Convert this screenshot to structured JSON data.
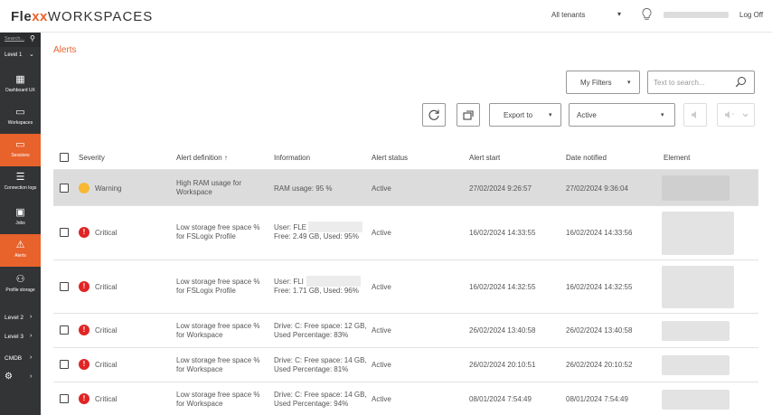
{
  "brand": {
    "flex": "Fle",
    "xx": "xx",
    "workspaces": "WORKSPACES"
  },
  "topbar": {
    "tenant": "All tenants",
    "logoff": "Log Off"
  },
  "sidebar": {
    "search_placeholder": "Search...",
    "level1": "Level 1",
    "items": [
      {
        "label": "Dashboard UX",
        "icon": "dashboard-icon"
      },
      {
        "label": "Workspaces",
        "icon": "monitor-icon"
      },
      {
        "label": "Sessions",
        "icon": "sessions-icon"
      },
      {
        "label": "Connection logs",
        "icon": "list-icon"
      },
      {
        "label": "Jobs",
        "icon": "jobs-icon"
      },
      {
        "label": "Alerts",
        "icon": "alert-icon"
      },
      {
        "label": "Profile storage",
        "icon": "profile-storage-icon"
      }
    ],
    "levels": [
      "Level 2",
      "Level 3",
      "CMDB"
    ]
  },
  "page": {
    "title": "Alerts"
  },
  "toolbar": {
    "my_filters": "My Filters",
    "search_placeholder": "Text to search...",
    "export": "Export to",
    "status_filter": "Active"
  },
  "table": {
    "headers": [
      "Severity",
      "Alert definition ↑",
      "Information",
      "Alert status",
      "Alert start",
      "Date notified",
      "Element"
    ],
    "rows": [
      {
        "severity": "Warning",
        "definition": [
          "High RAM usage for",
          "Workspace"
        ],
        "info": [
          "RAM usage: 95 %"
        ],
        "status": "Active",
        "start": "27/02/2024 9:26:57",
        "notified": "27/02/2024 9:36:04"
      },
      {
        "severity": "Critical",
        "definition": [
          "Low storage free space %",
          "for FSLogix Profile"
        ],
        "info": [
          "User: FLE",
          "Free: 2.49 GB, Used: 95%"
        ],
        "status": "Active",
        "start": "16/02/2024 14:33:55",
        "notified": "16/02/2024 14:33:56"
      },
      {
        "severity": "Critical",
        "definition": [
          "Low storage free space %",
          "for FSLogix Profile"
        ],
        "info": [
          "User: FLI",
          "Free: 1.71 GB, Used: 96%"
        ],
        "status": "Active",
        "start": "16/02/2024 14:32:55",
        "notified": "16/02/2024 14:32:55"
      },
      {
        "severity": "Critical",
        "definition": [
          "Low storage free space %",
          "for Workspace"
        ],
        "info": [
          "Drive: C: Free space: 12 GB,",
          "Used Percentage: 83%"
        ],
        "status": "Active",
        "start": "26/02/2024 13:40:58",
        "notified": "26/02/2024 13:40:58"
      },
      {
        "severity": "Critical",
        "definition": [
          "Low storage free space %",
          "for Workspace"
        ],
        "info": [
          "Drive: C: Free space: 14 GB,",
          "Used Percentage: 81%"
        ],
        "status": "Active",
        "start": "26/02/2024 20:10:51",
        "notified": "26/02/2024 20:10:52"
      },
      {
        "severity": "Critical",
        "definition": [
          "Low storage free space %",
          "for Workspace"
        ],
        "info": [
          "Drive: C: Free space: 14 GB,",
          "Used Percentage: 94%"
        ],
        "status": "Active",
        "start": "08/01/2024 7:54:49",
        "notified": "08/01/2024 7:54:49"
      }
    ]
  },
  "colors": {
    "accent": "#e8622b",
    "sidebar": "#333436",
    "warning": "#f7b833",
    "critical": "#e02424"
  }
}
